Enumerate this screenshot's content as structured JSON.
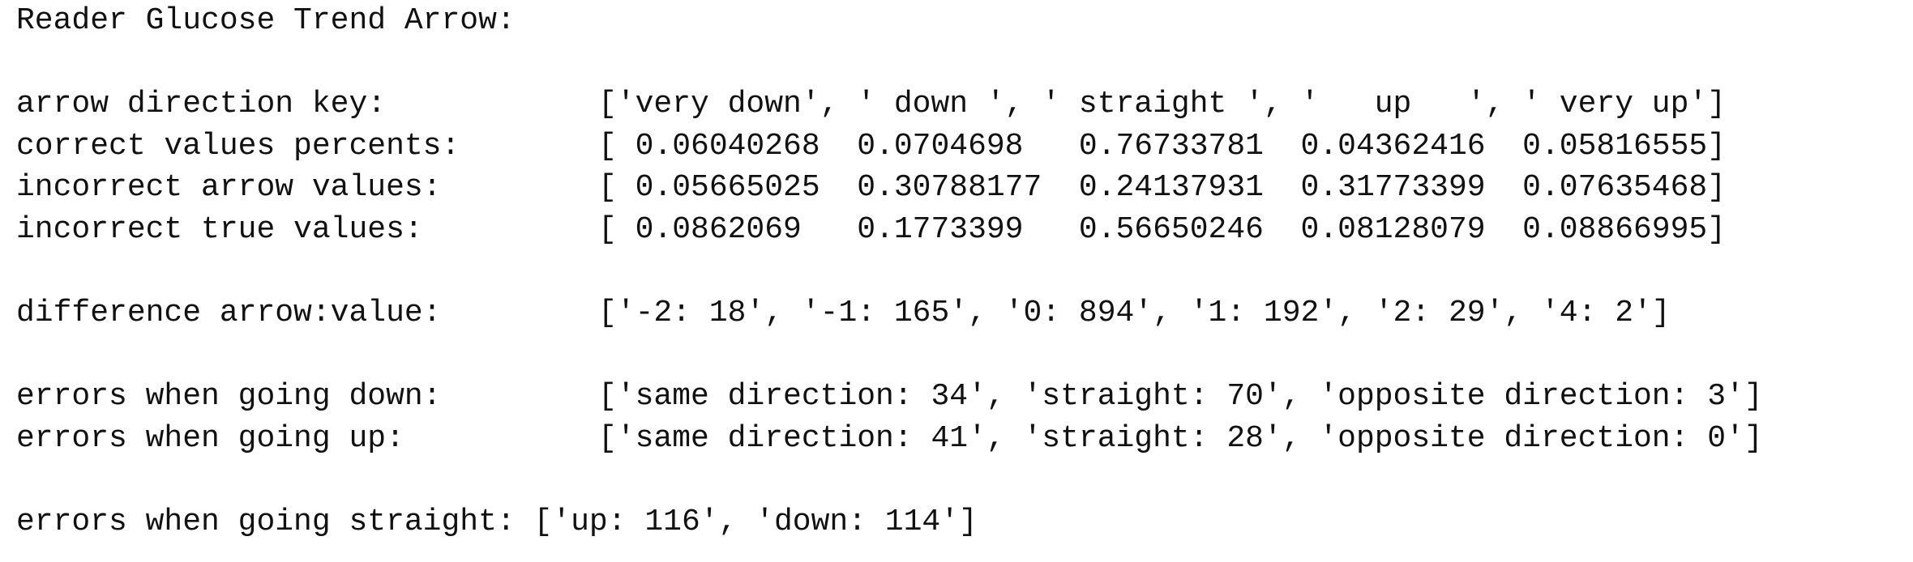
{
  "title": "Reader Glucose Trend Arrow:",
  "rows": [
    {
      "label": "arrow direction key:",
      "value": "['very down', ' down ', ' straight ', '   up   ', ' very up']"
    },
    {
      "label": "correct values percents:",
      "value": "[ 0.06040268  0.0704698   0.76733781  0.04362416  0.05816555]"
    },
    {
      "label": "incorrect arrow values:",
      "value": "[ 0.05665025  0.30788177  0.24137931  0.31773399  0.07635468]"
    },
    {
      "label": "incorrect true values:",
      "value": "[ 0.0862069   0.1773399   0.56650246  0.08128079  0.08866995]"
    },
    {
      "label": "difference arrow:value:",
      "value": "['-2: 18', '-1: 165', '0: 894', '1: 192', '2: 29', '4: 2']"
    },
    {
      "label": "errors when going down:",
      "value": "['same direction: 34', 'straight: 70', 'opposite direction: 3']"
    },
    {
      "label": "errors when going up:",
      "value": "['same direction: 41', 'straight: 28', 'opposite direction: 0']"
    },
    {
      "label": "errors when going straight:",
      "value": "['up: 116', 'down: 114']"
    }
  ]
}
